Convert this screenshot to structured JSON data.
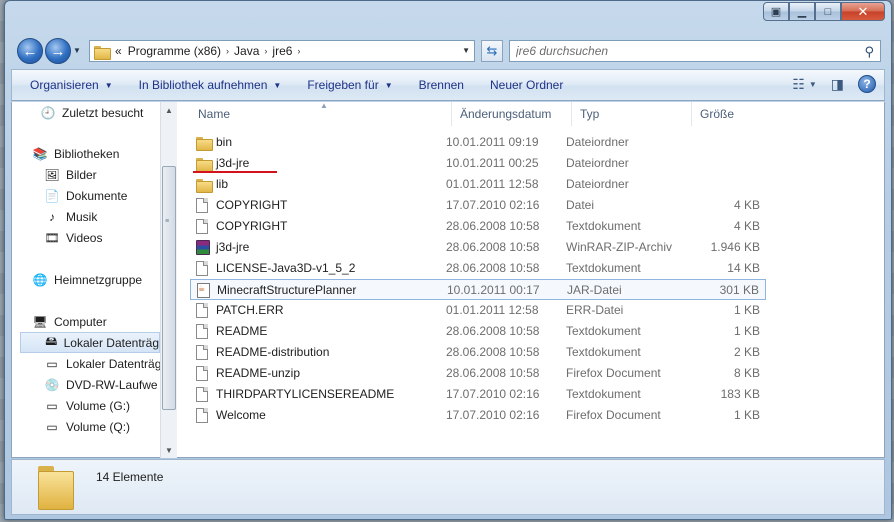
{
  "address": {
    "path_prefix": "«",
    "crumbs": [
      "Programme (x86)",
      "Java",
      "jre6"
    ],
    "separator": "›"
  },
  "search": {
    "placeholder": "jre6 durchsuchen"
  },
  "toolbar": {
    "organize": "Organisieren",
    "library": "In Bibliothek aufnehmen",
    "share": "Freigeben für",
    "burn": "Brennen",
    "new_folder": "Neuer Ordner"
  },
  "nav": {
    "recent": "Zuletzt besucht",
    "libraries": "Bibliotheken",
    "pictures": "Bilder",
    "documents": "Dokumente",
    "music": "Musik",
    "videos": "Videos",
    "homegroup": "Heimnetzgruppe",
    "computer": "Computer",
    "local_disk_1": "Lokaler Datenträg",
    "local_disk_2": "Lokaler Datenträg",
    "dvd": "DVD-RW-Laufwe",
    "vol_g": "Volume (G:)",
    "vol_q": "Volume (Q:)"
  },
  "columns": {
    "name": "Name",
    "date": "Änderungsdatum",
    "type": "Typ",
    "size": "Größe"
  },
  "files": [
    {
      "name": "bin",
      "date": "10.01.2011 09:19",
      "type": "Dateiordner",
      "size": "",
      "icon": "folder-icon"
    },
    {
      "name": "j3d-jre",
      "date": "10.01.2011 00:25",
      "type": "Dateiordner",
      "size": "",
      "icon": "folder-icon"
    },
    {
      "name": "lib",
      "date": "01.01.2011 12:58",
      "type": "Dateiordner",
      "size": "",
      "icon": "folder-icon"
    },
    {
      "name": "COPYRIGHT",
      "date": "17.07.2010 02:16",
      "type": "Datei",
      "size": "4 KB",
      "icon": "file-icon"
    },
    {
      "name": "COPYRIGHT",
      "date": "28.06.2008 10:58",
      "type": "Textdokument",
      "size": "4 KB",
      "icon": "file-icon"
    },
    {
      "name": "j3d-jre",
      "date": "28.06.2008 10:58",
      "type": "WinRAR-ZIP-Archiv",
      "size": "1.946 KB",
      "icon": "winrar-icon"
    },
    {
      "name": "LICENSE-Java3D-v1_5_2",
      "date": "28.06.2008 10:58",
      "type": "Textdokument",
      "size": "14 KB",
      "icon": "file-icon"
    },
    {
      "name": "MinecraftStructurePlanner",
      "date": "10.01.2011 00:17",
      "type": "JAR-Datei",
      "size": "301 KB",
      "icon": "jar-icon"
    },
    {
      "name": "PATCH.ERR",
      "date": "01.01.2011 12:58",
      "type": "ERR-Datei",
      "size": "1 KB",
      "icon": "file-icon"
    },
    {
      "name": "README",
      "date": "28.06.2008 10:58",
      "type": "Textdokument",
      "size": "1 KB",
      "icon": "file-icon"
    },
    {
      "name": "README-distribution",
      "date": "28.06.2008 10:58",
      "type": "Textdokument",
      "size": "2 KB",
      "icon": "file-icon"
    },
    {
      "name": "README-unzip",
      "date": "28.06.2008 10:58",
      "type": "Firefox Document",
      "size": "8 KB",
      "icon": "file-icon"
    },
    {
      "name": "THIRDPARTYLICENSEREADME",
      "date": "17.07.2010 02:16",
      "type": "Textdokument",
      "size": "183 KB",
      "icon": "file-icon"
    },
    {
      "name": "Welcome",
      "date": "17.07.2010 02:16",
      "type": "Firefox Document",
      "size": "1 KB",
      "icon": "file-icon"
    }
  ],
  "status": {
    "count": "14 Elemente"
  },
  "colors": {
    "accent_underline": "#d4111d",
    "toolbar_text": "#1e3287"
  }
}
